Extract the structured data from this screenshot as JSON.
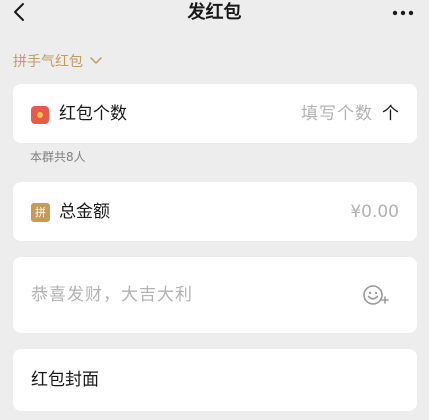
{
  "header": {
    "title": "发红包",
    "back_icon": "chevron-left-icon",
    "more_icon": "more-dots-icon"
  },
  "packet_type": {
    "label": "拼手气红包",
    "icon": "chevron-down-icon"
  },
  "count": {
    "label": "红包个数",
    "placeholder": "填写个数",
    "unit": "个",
    "icon": "red-packet-icon"
  },
  "group_note": "本群共8人",
  "amount": {
    "label": "总金额",
    "placeholder": "¥0.00",
    "badge": "拼",
    "icon": "pin-badge-icon"
  },
  "greeting": {
    "placeholder": "恭喜发财，大吉大利",
    "emoji_icon": "emoji-add-icon"
  },
  "cover": {
    "label": "红包封面"
  },
  "colors": {
    "accent": "#C39B5B",
    "red": "#E8594B",
    "background": "#EDEDED",
    "placeholder": "#B2B2B2"
  }
}
